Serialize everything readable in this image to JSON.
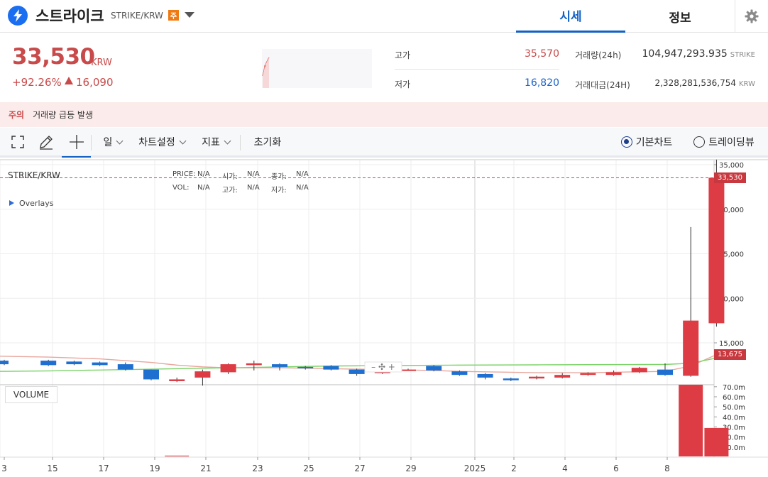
{
  "header": {
    "coin_name": "스트라이크",
    "pair": "STRIKE/KRW",
    "warning_badge": "주",
    "tabs": [
      {
        "label": "시세"
      },
      {
        "label": "정보"
      }
    ]
  },
  "price": {
    "current": "33,530",
    "unit": "KRW",
    "change_pct": "+92.26%",
    "change_abs": "16,090"
  },
  "stats": {
    "high_label": "고가",
    "high_value": "35,570",
    "low_label": "저가",
    "low_value": "16,820",
    "volume_label": "거래량(24h)",
    "volume_value": "104,947,293.935",
    "volume_unit": "STRIKE",
    "amount_label": "거래대금(24H)",
    "amount_value": "2,328,281,536,754",
    "amount_unit": "KRW"
  },
  "notice": {
    "tag": "주의",
    "text": "거래량 급등 발생"
  },
  "toolbar": {
    "period": "일",
    "chart_settings": "차트설정",
    "indicators": "지표",
    "reset": "초기화",
    "basic_chart": "기본차트",
    "tradingview": "트레이딩뷰",
    "selected": "basic_chart"
  },
  "chart_legend": {
    "pair": "STRIKE/KRW",
    "price_label": "PRICE:",
    "price_value": "N/A",
    "open_label": "시가:",
    "open_value": "N/A",
    "close_label": "종가:",
    "close_value": "N/A",
    "vol_label": "VOL:",
    "vol_value": "N/A",
    "high_label": "고가:",
    "high_value": "N/A",
    "low_label": "저가:",
    "low_value": "N/A",
    "overlays": "Overlays",
    "volume": "VOLUME"
  },
  "colors": {
    "up": "#dd3c44",
    "down": "#1f6fd1",
    "accent": "#1261c4",
    "ma_short": "#e8a79e",
    "ma_long": "#7dd36a",
    "current_tag": "#c8393f"
  },
  "chart_data": {
    "type": "candlestick",
    "price_axis_ticks": [
      "35,000",
      "30,000",
      "25,000",
      "20,000",
      "15,000"
    ],
    "volume_axis_ticks": [
      "70.0m",
      "60.0m",
      "50.0m",
      "40.0m",
      "30.0m",
      "20.0m",
      "10.0m"
    ],
    "x_tick_labels": [
      "3",
      "15",
      "17",
      "19",
      "21",
      "23",
      "25",
      "27",
      "29",
      "2025",
      "2",
      "4",
      "6",
      "8"
    ],
    "ylim": [
      11000,
      36000
    ],
    "current_price_tag": "33,530",
    "ma_price_tag": "13,675",
    "candles": [
      {
        "x": 0,
        "o": 13000,
        "c": 12600,
        "h": 13100,
        "l": 12500
      },
      {
        "x": 1,
        "o": 13000,
        "c": 12500,
        "h": 13100,
        "l": 12400
      },
      {
        "x": 2,
        "o": 12900,
        "c": 12600,
        "h": 13000,
        "l": 12500
      },
      {
        "x": 3,
        "o": 12800,
        "c": 12500,
        "h": 12900,
        "l": 12400
      },
      {
        "x": 4,
        "o": 12600,
        "c": 12000,
        "h": 12800,
        "l": 11900
      },
      {
        "x": 5,
        "o": 12000,
        "c": 10900,
        "h": 12000,
        "l": 10800
      },
      {
        "x": 6,
        "o": 10700,
        "c": 10900,
        "h": 11100,
        "l": 10600
      },
      {
        "x": 7,
        "o": 11100,
        "c": 11800,
        "h": 12000,
        "l": 10200
      },
      {
        "x": 8,
        "o": 11700,
        "c": 12600,
        "h": 12700,
        "l": 11500
      },
      {
        "x": 9,
        "o": 12500,
        "c": 12700,
        "h": 13000,
        "l": 11900
      },
      {
        "x": 10,
        "o": 12600,
        "c": 12300,
        "h": 12700,
        "l": 11900
      },
      {
        "x": 11,
        "o": 12300,
        "c": 12200,
        "h": 12400,
        "l": 12000
      },
      {
        "x": 12,
        "o": 12400,
        "c": 12000,
        "h": 12500,
        "l": 11900
      },
      {
        "x": 13,
        "o": 12000,
        "c": 11500,
        "h": 12100,
        "l": 11300
      },
      {
        "x": 14,
        "o": 11600,
        "c": 12100,
        "h": 12400,
        "l": 11500
      },
      {
        "x": 15,
        "o": 12000,
        "c": 12000,
        "h": 12100,
        "l": 11900
      },
      {
        "x": 16,
        "o": 12400,
        "c": 11900,
        "h": 12500,
        "l": 11800
      },
      {
        "x": 17,
        "o": 11800,
        "c": 11400,
        "h": 11900,
        "l": 11300
      },
      {
        "x": 18,
        "o": 11500,
        "c": 11100,
        "h": 11600,
        "l": 10900
      },
      {
        "x": 19,
        "o": 11000,
        "c": 10800,
        "h": 11100,
        "l": 10700
      },
      {
        "x": 20,
        "o": 11000,
        "c": 11200,
        "h": 11300,
        "l": 10900
      },
      {
        "x": 21,
        "o": 11100,
        "c": 11400,
        "h": 11600,
        "l": 11000
      },
      {
        "x": 22,
        "o": 11400,
        "c": 11600,
        "h": 11700,
        "l": 11300
      },
      {
        "x": 23,
        "o": 11400,
        "c": 11700,
        "h": 11900,
        "l": 11300
      },
      {
        "x": 24,
        "o": 11700,
        "c": 12200,
        "h": 12300,
        "l": 11600
      },
      {
        "x": 25,
        "o": 12000,
        "c": 11400,
        "h": 12700,
        "l": 11300
      },
      {
        "x": 26,
        "o": 11300,
        "c": 17500,
        "h": 28000,
        "l": 11200
      },
      {
        "x": 27,
        "o": 17200,
        "c": 33530,
        "h": 35570,
        "l": 16820
      }
    ],
    "ma_short": [
      13500,
      13400,
      13300,
      13200,
      13000,
      12800,
      12500,
      12300,
      12200,
      12200,
      12200,
      12150,
      12100,
      12050,
      12000,
      11950,
      11900,
      11800,
      11750,
      11700,
      11650,
      11650,
      11650,
      11700,
      11750,
      11800,
      12400,
      13675
    ],
    "ma_long": [
      11800,
      11850,
      11900,
      11950,
      12000,
      12050,
      12100,
      12150,
      12200,
      12250,
      12300,
      12350,
      12400,
      12420,
      12440,
      12460,
      12480,
      12500,
      12510,
      12520,
      12530,
      12540,
      12550,
      12560,
      12570,
      12580,
      12700,
      13300
    ],
    "volumes_m": [
      0,
      0,
      0,
      0,
      0,
      0,
      1.5,
      0,
      0,
      0,
      0,
      0,
      0,
      0,
      0,
      0,
      0,
      0,
      0,
      0,
      0,
      0,
      0,
      0,
      0,
      0,
      72,
      29
    ],
    "volume_ylim": [
      0,
      72
    ]
  }
}
